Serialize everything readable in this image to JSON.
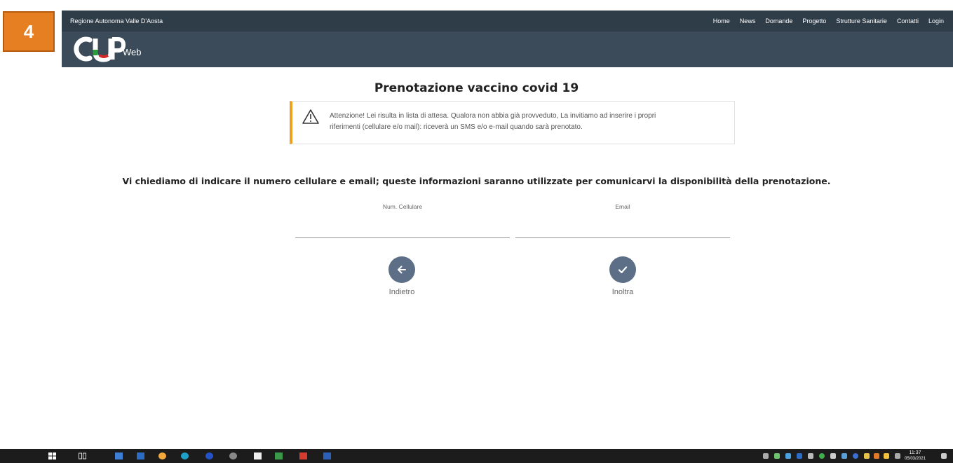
{
  "step_badge": "4",
  "header": {
    "region": "Regione Autonoma Valle D'Aosta",
    "logo_suffix": "Web",
    "nav": [
      "Home",
      "News",
      "Domande",
      "Progetto",
      "Strutture Sanitarie",
      "Contatti",
      "Login"
    ]
  },
  "main": {
    "title": "Prenotazione vaccino covid 19",
    "alert_line1": "Attenzione! Lei risulta in lista di attesa. Qualora non abbia già provveduto, La invitiamo ad inserire i propri",
    "alert_line2": "riferimenti (cellulare e/o mail): riceverà un SMS e/o e-mail quando sarà prenotato.",
    "prompt": "Vi chiediamo di indicare il numero cellulare e email; queste informazioni saranno utilizzate per comunicarvi la disponibilità della prenotazione.",
    "phone_label": "Num. Cellulare",
    "phone_value": "",
    "email_label": "Email",
    "email_value": "",
    "back_label": "Indietro",
    "submit_label": "Inoltra"
  },
  "taskbar": {
    "time": "11:37",
    "date": "05/03/2021"
  },
  "colors": {
    "header_bg": "#3b4b59",
    "topbar_bg": "#2f3d49",
    "alert_accent": "#f0a020",
    "button_bg": "#5d6f86",
    "badge_bg": "#e67e22"
  },
  "icons": [
    "warning-icon",
    "arrow-left-icon",
    "check-icon",
    "windows-start-icon"
  ]
}
